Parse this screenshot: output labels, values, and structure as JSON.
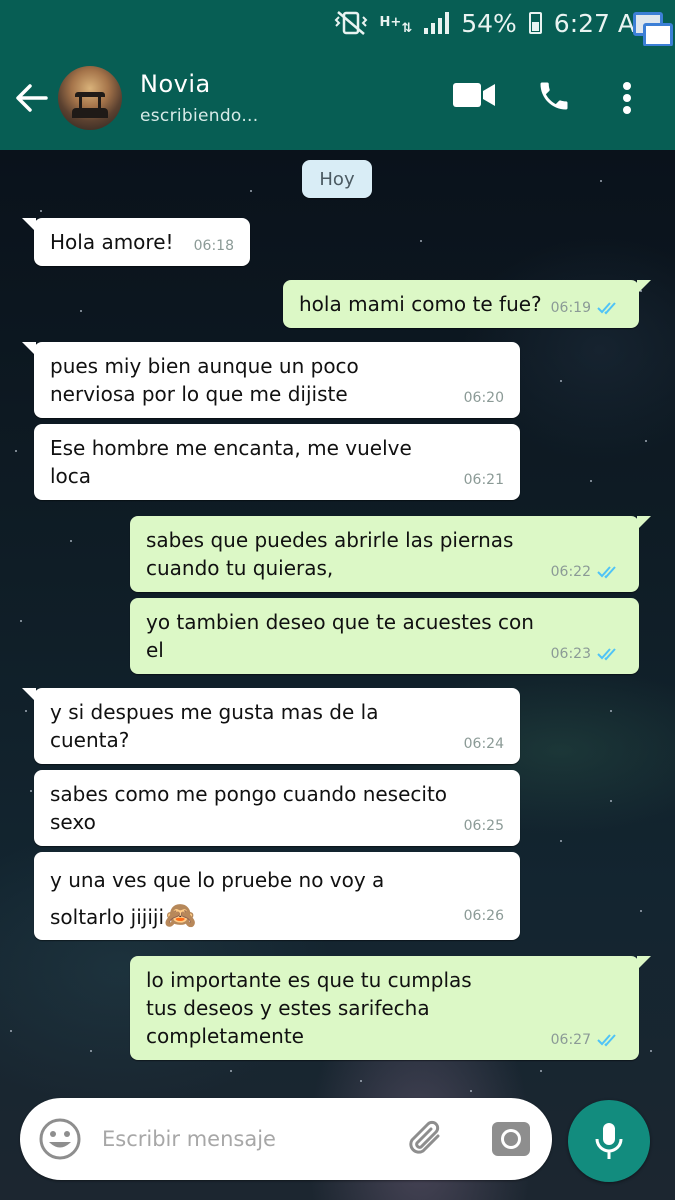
{
  "status_bar": {
    "network": "H+",
    "battery": "54%",
    "time": "6:27 A"
  },
  "header": {
    "contact_name": "Novia",
    "contact_status": "escribiendo..."
  },
  "chat": {
    "date_label": "Hoy",
    "messages": [
      {
        "direction": "in",
        "text": "Hola amore!",
        "time": "06:18"
      },
      {
        "direction": "out",
        "text": "hola mami como te fue?",
        "time": "06:19"
      },
      {
        "direction": "in",
        "text": "pues miy bien aunque un poco\nnerviosa por lo que me dijiste",
        "time": "06:20"
      },
      {
        "direction": "in",
        "text": "Ese hombre me encanta, me vuelve\nloca",
        "time": "06:21"
      },
      {
        "direction": "out",
        "text": "sabes que puedes abrirle las piernas\ncuando tu quieras,",
        "time": "06:22"
      },
      {
        "direction": "out",
        "text": "yo tambien deseo que te acuestes con\nel",
        "time": "06:23"
      },
      {
        "direction": "in",
        "text": "y si despues me gusta mas de la\ncuenta?",
        "time": "06:24"
      },
      {
        "direction": "in",
        "text": "sabes como me pongo cuando nesecito\nsexo",
        "time": "06:25"
      },
      {
        "direction": "in",
        "text": "y una ves que lo pruebe no voy a\nsoltarlo jijiji",
        "emoji": "🙈",
        "time": "06:26"
      },
      {
        "direction": "out",
        "text": "lo importante es que tu cumplas\ntus deseos y estes sarifecha\ncompletamente",
        "time": "06:27"
      }
    ]
  },
  "input": {
    "placeholder": "Escribir mensaje"
  },
  "colors": {
    "header": "#075e54",
    "outgoing_bubble": "#dcf8c6",
    "incoming_bubble": "#ffffff",
    "read_ticks": "#4fc3f7",
    "mic_button": "#128c7e"
  }
}
